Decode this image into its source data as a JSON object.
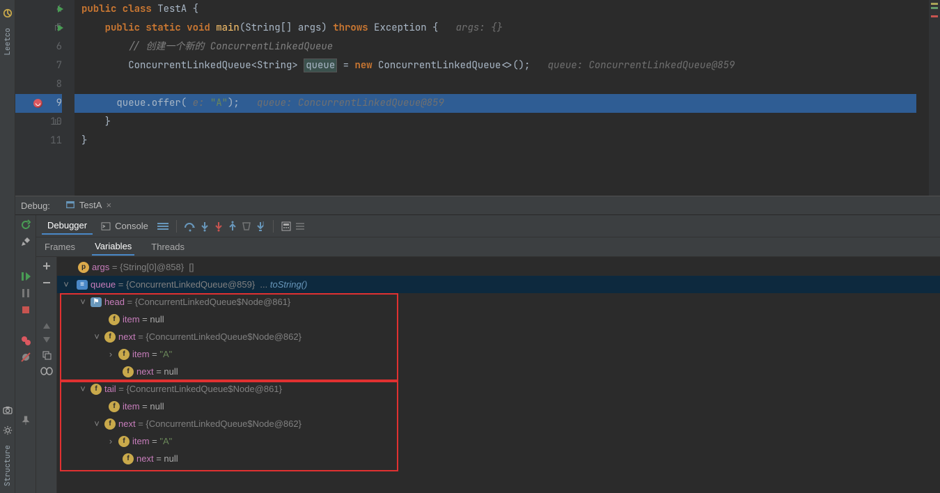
{
  "side_tabs": {
    "leetco": "Leetco",
    "structure": "Structure"
  },
  "editor": {
    "lines": [
      4,
      5,
      6,
      7,
      8,
      9,
      10,
      11
    ],
    "code": {
      "l4": "public class TestA {",
      "l5_kw": "public static void",
      "l5_fn": "main",
      "l5_sig": "(String[] args)",
      "l5_throws": "throws",
      "l5_exc": "Exception {",
      "l5_hint": "args: {}",
      "l6_cmt": "// 创建一个新的 ConcurrentLinkedQueue",
      "l7_a": "ConcurrentLinkedQueue<String>",
      "l7_var": "queue",
      "l7_b": "= ",
      "l7_new": "new",
      "l7_c": " ConcurrentLinkedQueue<>();",
      "l7_hint": "queue: ConcurrentLinkedQueue@859",
      "l9_a": "queue.offer(",
      "l9_p": " e: ",
      "l9_s": "\"A\"",
      "l9_b": ");",
      "l9_hint": "queue: ConcurrentLinkedQueue@859",
      "l10": "}",
      "l11": "}"
    }
  },
  "debug": {
    "label": "Debug:",
    "tab": "TestA",
    "tabs": {
      "debugger": "Debugger",
      "console": "Console"
    },
    "subtabs": {
      "frames": "Frames",
      "variables": "Variables",
      "threads": "Threads"
    },
    "vars": {
      "args_name": "args",
      "args_val": " = {String[0]@858}  []",
      "queue_name": "queue",
      "queue_val": " = {ConcurrentLinkedQueue@859}  ... ",
      "queue_link": "toString()",
      "head_name": "head",
      "head_val": " = {ConcurrentLinkedQueue$Node@861}",
      "item_name": "item",
      "item_null": " = null",
      "next_name": "next",
      "next_val": " = {ConcurrentLinkedQueue$Node@862}",
      "item_a": " = \"A\"",
      "tail_name": "tail",
      "tail_val": " = {ConcurrentLinkedQueue$Node@861}"
    }
  }
}
